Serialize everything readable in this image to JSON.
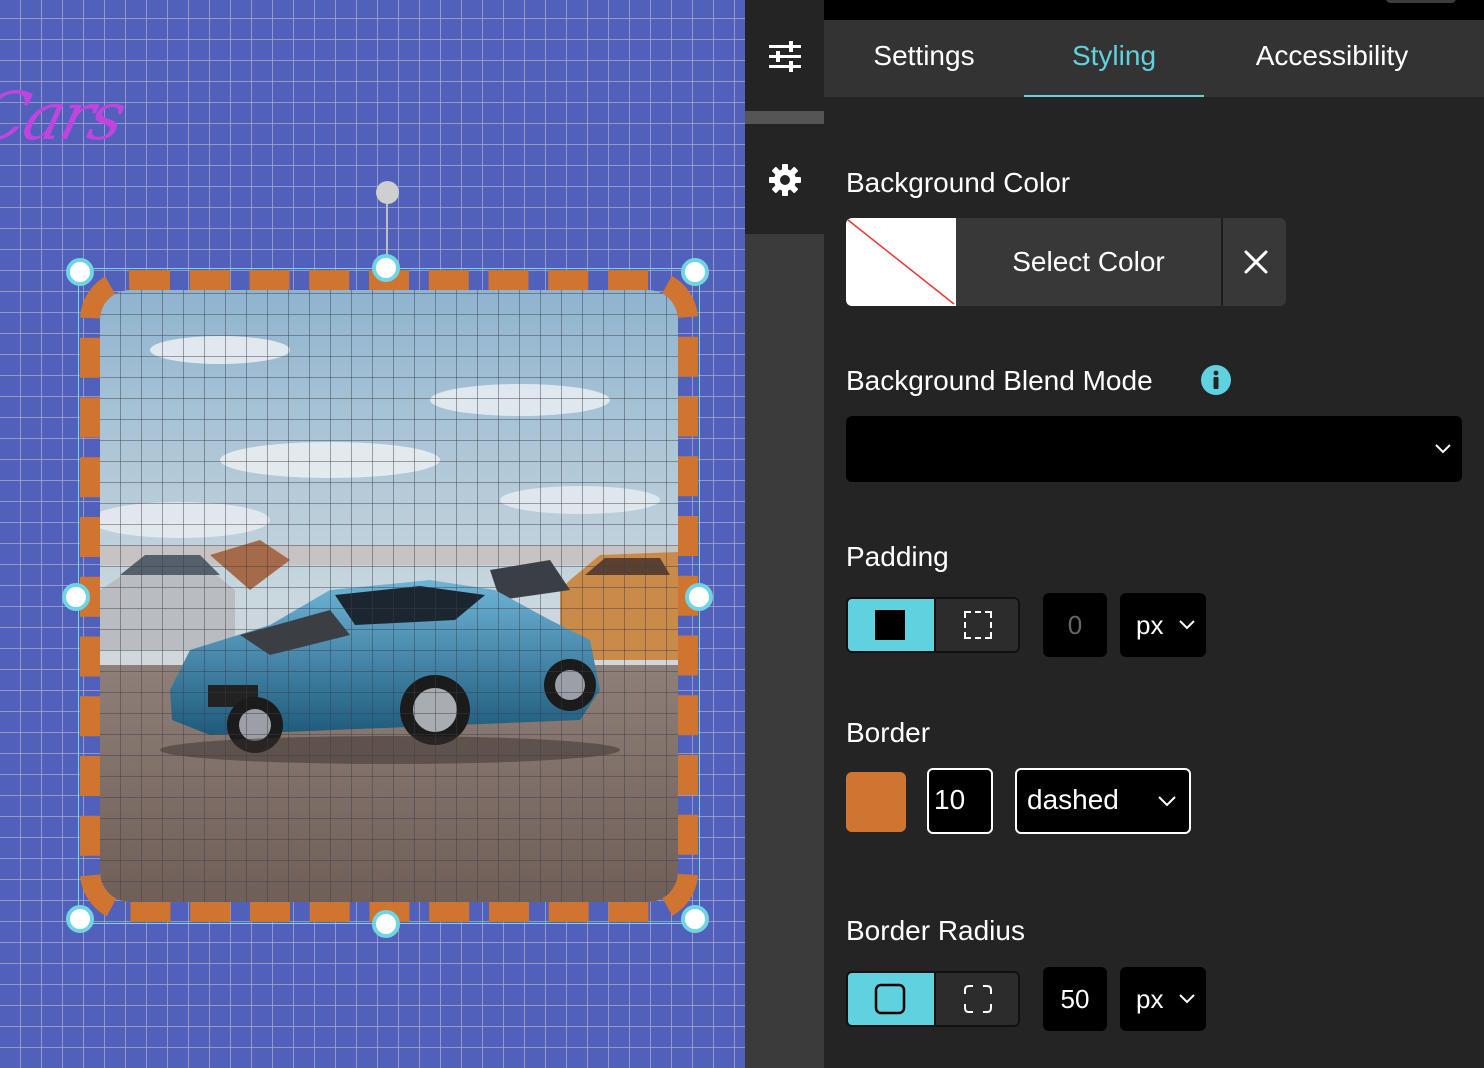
{
  "canvas": {
    "logo_text": "Cars",
    "image_alt": "Blue sports car parked on a lot with other cars under a cloudy sky"
  },
  "toolbar": {
    "icons": [
      "sliders-icon",
      "gear-icon"
    ]
  },
  "panel": {
    "tabs": [
      {
        "label": "Settings",
        "active": false
      },
      {
        "label": "Styling",
        "active": true
      },
      {
        "label": "Accessibility",
        "active": false
      }
    ],
    "background_color": {
      "label": "Background Color",
      "button_label": "Select Color",
      "value": "none"
    },
    "blend_mode": {
      "label": "Background Blend Mode",
      "value": ""
    },
    "padding": {
      "label": "Padding",
      "value": "0",
      "unit": "px",
      "mode": "all-sides"
    },
    "border": {
      "label": "Border",
      "color": "#d07530",
      "width": "10",
      "style": "dashed"
    },
    "border_radius": {
      "label": "Border Radius",
      "value": "50",
      "unit": "px",
      "mode": "all-corners"
    }
  },
  "colors": {
    "accent": "#5fd1df",
    "canvas_bg": "#5160bb",
    "border_color": "#d07530",
    "logo": "#c244df"
  }
}
